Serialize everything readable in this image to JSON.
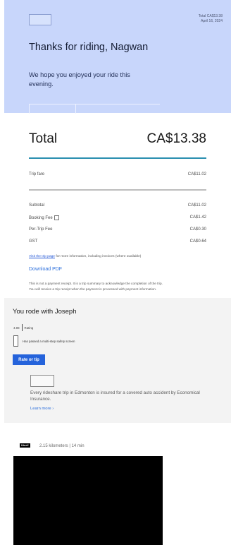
{
  "header": {
    "meta_total": "Total CA$13.38",
    "meta_date": "April 16, 2024",
    "title": "Thanks for riding, Nagwan",
    "subtitle": "We hope you enjoyed your ride this evening."
  },
  "receipt": {
    "total_label": "Total",
    "total_value": "CA$13.38",
    "trip_fare_label": "Trip fare",
    "trip_fare_value": "CA$11.02",
    "subtotal_label": "Subtotal",
    "subtotal_value": "CA$11.02",
    "booking_fee_label": "Booking Fee",
    "booking_fee_value": "CA$1.42",
    "per_trip_fee_label": "Per-Trip Fee",
    "per_trip_fee_value": "CA$0.30",
    "gst_label": "GST",
    "gst_value": "CA$0.64",
    "visit_link": "Visit the trip page",
    "visit_rest": " for more information, including invoices (where available)",
    "download_label": "Download PDF",
    "note_line1": "This is not a payment receipt. It is a trip summary to acknowledge the completion of the trip.",
    "note_line2": "You will receive a trip receipt when the payment is processed with payment information."
  },
  "driver": {
    "heading": "You rode with Joseph",
    "rating_value": "4.98",
    "rating_label": "Rating",
    "safety_text": "Has passed a multi-step safety screen",
    "rate_button": "Rate or tip",
    "insurance_text": "Every rideshare trip in Edmonton is insured for a covered auto accident by Economical Insurance.",
    "learn_more": "Learn more ›"
  },
  "trip": {
    "badge": "UberX",
    "distance": "2.15 kilometers | 14 min"
  }
}
